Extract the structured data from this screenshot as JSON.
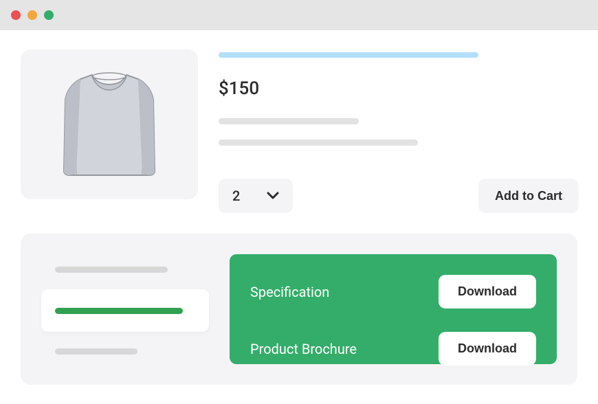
{
  "product": {
    "price": "$150",
    "quantity": "2",
    "add_to_cart_label": "Add to Cart"
  },
  "downloads": [
    {
      "label": "Specification",
      "button": "Download"
    },
    {
      "label": "Product Brochure",
      "button": "Download"
    }
  ]
}
